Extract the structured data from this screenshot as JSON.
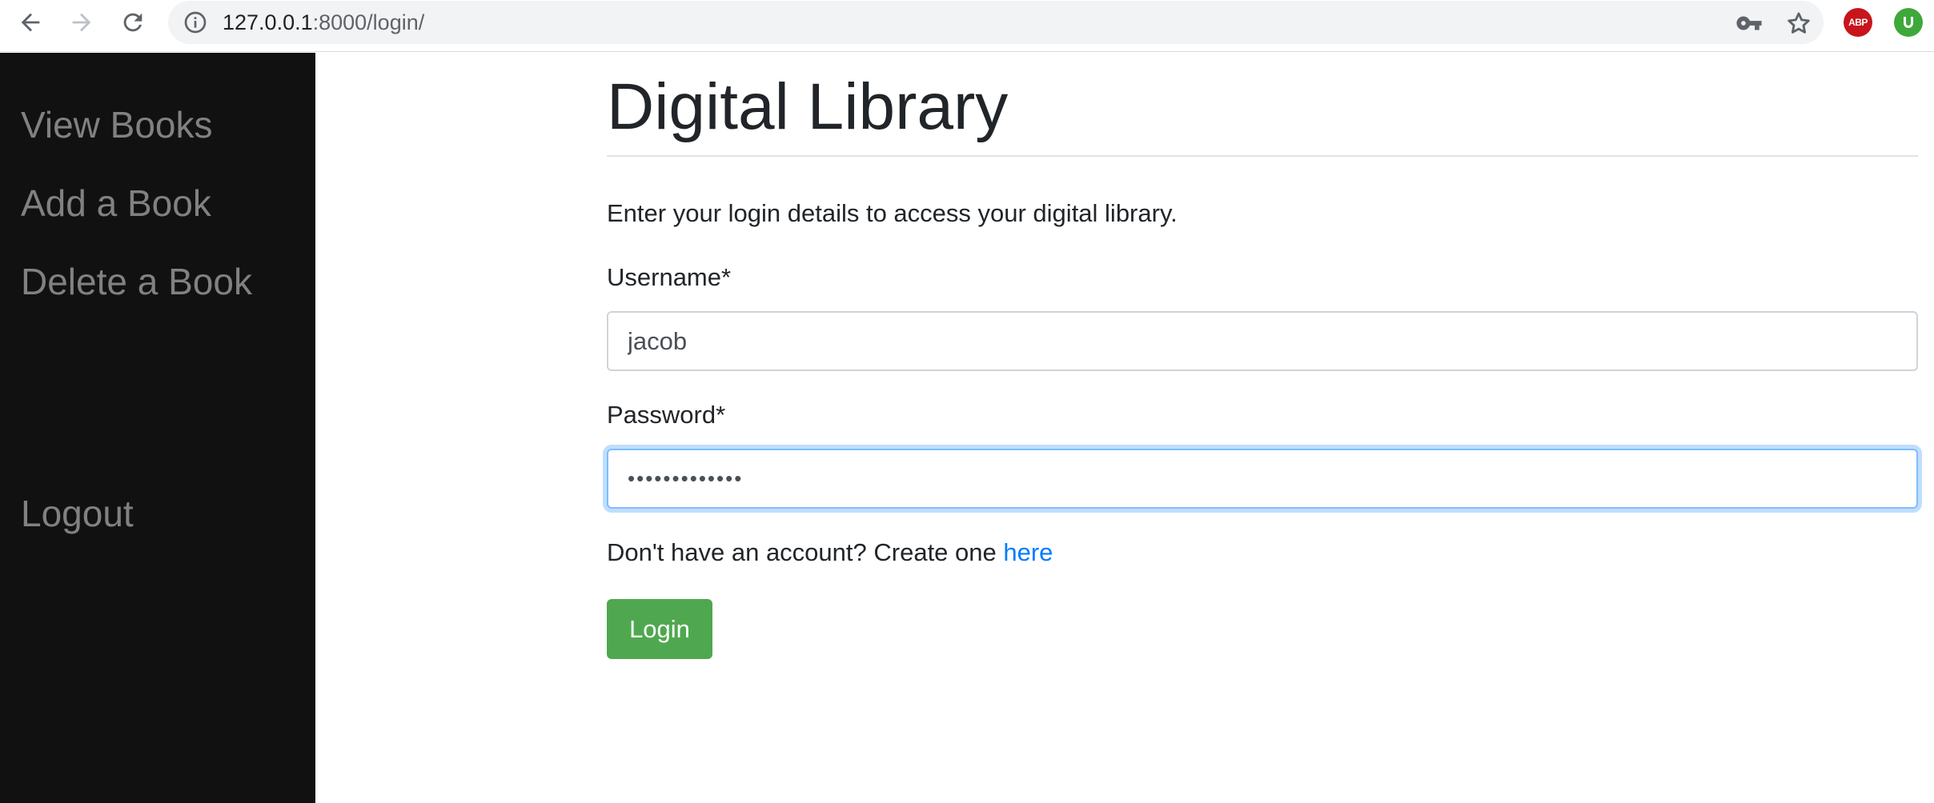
{
  "browser": {
    "url_host": "127.0.0.1",
    "url_path": ":8000/login/"
  },
  "sidebar": {
    "items": [
      {
        "label": "View Books"
      },
      {
        "label": "Add a Book"
      },
      {
        "label": "Delete a Book"
      }
    ],
    "logout_label": "Logout"
  },
  "main": {
    "title": "Digital Library",
    "intro": "Enter your login details to access your digital library.",
    "username_label": "Username*",
    "username_value": "jacob",
    "password_label": "Password*",
    "password_value": "•••••••••••••",
    "signup_text": "Don't have an account? Create one ",
    "signup_link": "here",
    "login_button": "Login"
  },
  "colors": {
    "sidebar_bg": "#111111",
    "sidebar_link": "#818181",
    "link": "#007bff",
    "login_button": "#4fa84f",
    "focus_ring": "#80bdff"
  }
}
